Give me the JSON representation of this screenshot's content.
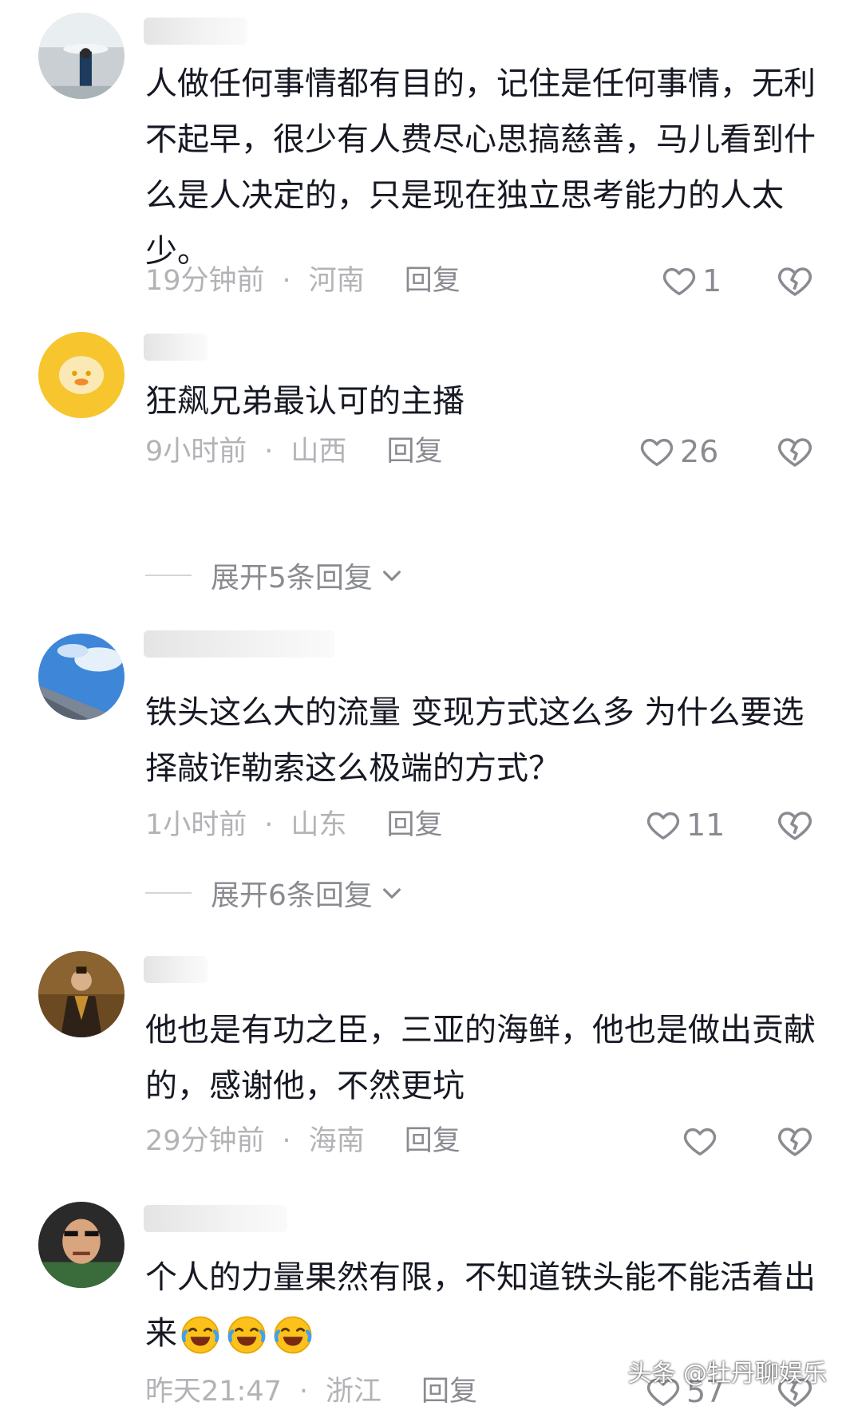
{
  "comments": [
    {
      "text": "人做任何事情都有目的，记住是任何事情，无利不起早，很少有人费尽心思搞慈善，马儿看到什么是人决定的，只是现在独立思考能力的人太少。",
      "time": "19分钟前",
      "location": "河南",
      "reply_label": "回复",
      "likes": "1"
    },
    {
      "text": "狂飙兄弟最认可的主播",
      "time": "9小时前",
      "location": "山西",
      "reply_label": "回复",
      "likes": "26",
      "expand_label": "展开5条回复"
    },
    {
      "text": "铁头这么大的流量 变现方式这么多  为什么要选择敲诈勒索这么极端的方式？",
      "time": "1小时前",
      "location": "山东",
      "reply_label": "回复",
      "likes": "11",
      "expand_label": "展开6条回复"
    },
    {
      "text": "他也是有功之臣，三亚的海鲜，他也是做出贡献的，感谢他，不然更坑",
      "time": "29分钟前",
      "location": "海南",
      "reply_label": "回复",
      "likes": ""
    },
    {
      "text": "个人的力量果然有限，不知道铁头能不能活着出来",
      "time": "昨天21:47",
      "location": "浙江",
      "reply_label": "回复",
      "likes": "57"
    }
  ],
  "meta_separator": "·",
  "watermark": "头条 @牡丹聊娱乐",
  "icons": {
    "like": "heart-outline-icon",
    "dislike": "broken-heart-icon",
    "expand": "chevron-down-icon",
    "emoji": "laughing-tears-emoji"
  },
  "colors": {
    "text": "#161823",
    "meta": "#b3b3b7",
    "action": "#8a8b91"
  }
}
